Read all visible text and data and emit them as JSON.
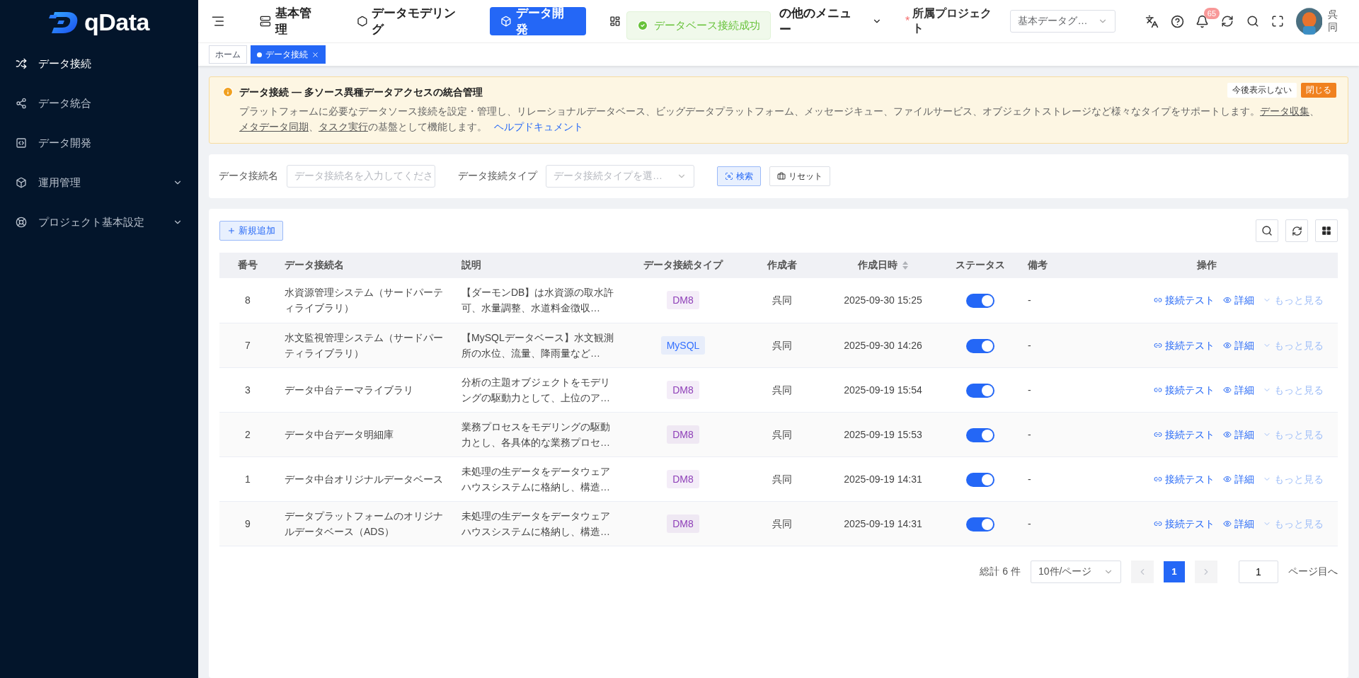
{
  "logo": {
    "text": "qData"
  },
  "sidebar": {
    "items": [
      {
        "label": "データ接続",
        "selected": true,
        "expandable": false
      },
      {
        "label": "データ統合",
        "selected": false,
        "expandable": false
      },
      {
        "label": "データ開発",
        "selected": false,
        "expandable": false
      },
      {
        "label": "運用管理",
        "selected": false,
        "expandable": true
      },
      {
        "label": "プロジェクト基本設定",
        "selected": false,
        "expandable": true
      }
    ]
  },
  "top_nav": {
    "items": [
      {
        "label": "基本管理",
        "selected": false,
        "dropdown": false
      },
      {
        "label": "データモデリング",
        "selected": false,
        "dropdown": false
      },
      {
        "label": "データ開発",
        "selected": true,
        "dropdown": false
      },
      {
        "label": "の他のメニュー",
        "selected": false,
        "dropdown": true
      }
    ]
  },
  "toast": {
    "text": "データベース接続成功"
  },
  "project": {
    "label": "所属プロジェクト",
    "required_mark": "*",
    "value": "基本データグ…"
  },
  "notifications": {
    "count": "65"
  },
  "user": {
    "name": "呉同"
  },
  "tabs": [
    {
      "label": "ホーム",
      "selected": false
    },
    {
      "label": "データ接続",
      "selected": true
    }
  ],
  "banner": {
    "title": "データ接続 — 多ソース異種データアクセスの統合管理",
    "body": [
      {
        "kind": "text",
        "text": "プラットフォームに必要なデータソース接続を設定・管理し、リレーショナルデータベース、ビッグデータプラットフォーム、メッセージキュー、ファイルサービス、オブジェクトストレージなど様々なタイプをサポートします。"
      },
      {
        "kind": "link",
        "text": "データ収集"
      },
      {
        "kind": "text",
        "text": "、"
      },
      {
        "kind": "link",
        "text": "メタデータ同期"
      },
      {
        "kind": "text",
        "text": "、"
      },
      {
        "kind": "link",
        "text": "タスク実行"
      },
      {
        "kind": "text",
        "text": "の基盤として機能します。"
      },
      {
        "kind": "help",
        "text": "ヘルプドキュメント"
      }
    ],
    "dismiss": "今後表示しない",
    "close": "閉じる"
  },
  "filters": [
    {
      "label": "データ接続名",
      "placeholder": "データ接続名を入力してくださ",
      "kind": "input"
    },
    {
      "label": "データ接続タイプ",
      "placeholder": "データ接続タイプを選…",
      "kind": "select"
    }
  ],
  "filter_buttons": {
    "search": "検索",
    "reset": "リセット"
  },
  "add_button": "新規追加",
  "table": {
    "columns": [
      {
        "label": "番号",
        "sortable": false
      },
      {
        "label": "データ接続名",
        "sortable": false
      },
      {
        "label": "説明",
        "sortable": false
      },
      {
        "label": "データ接続タイプ",
        "sortable": false
      },
      {
        "label": "作成者",
        "sortable": false
      },
      {
        "label": "作成日時",
        "sortable": true
      },
      {
        "label": "ステータス",
        "sortable": false
      },
      {
        "label": "備考",
        "sortable": false
      },
      {
        "label": "操作",
        "sortable": false
      }
    ],
    "rows": [
      {
        "no": "8",
        "name": "水資源管理システム（サードパーティライブラリ）",
        "description": "【ダーモンDB】は水資源の取水許可、水量調整、水道料金徴収…",
        "type": {
          "label": "DM8",
          "color": "#8e3fb8"
        },
        "creator": "呉同",
        "created": "2025-09-30 15:25",
        "enabled": true,
        "remarks": "-",
        "actions": [
          "接続テスト",
          "詳細",
          "もっと見る"
        ]
      },
      {
        "no": "7",
        "name": "水文監視管理システム（サードパーティライブラリ）",
        "description": "【MySQLデータベース】水文観測所の水位、流量、降雨量など…",
        "type": {
          "label": "MySQL",
          "color": "#3370ff"
        },
        "creator": "呉同",
        "created": "2025-09-30 14:26",
        "enabled": true,
        "remarks": "-",
        "actions": [
          "接続テスト",
          "詳細",
          "もっと見る"
        ]
      },
      {
        "no": "3",
        "name": "データ中台テーマライブラリ",
        "description": "分析の主題オブジェクトをモデリングの駆動力として、上位のア…",
        "type": {
          "label": "DM8",
          "color": "#8e3fb8"
        },
        "creator": "呉同",
        "created": "2025-09-19 15:54",
        "enabled": true,
        "remarks": "-",
        "actions": [
          "接続テスト",
          "詳細",
          "もっと見る"
        ]
      },
      {
        "no": "2",
        "name": "データ中台データ明細庫",
        "description": "業務プロセスをモデリングの駆動力とし、各具体的な業務プロセ…",
        "type": {
          "label": "DM8",
          "color": "#8e3fb8"
        },
        "creator": "呉同",
        "created": "2025-09-19 15:53",
        "enabled": true,
        "remarks": "-",
        "actions": [
          "接続テスト",
          "詳細",
          "もっと見る"
        ]
      },
      {
        "no": "1",
        "name": "データ中台オリジナルデータベース",
        "description": "未処理の生データをデータウェアハウスシステムに格納し、構造…",
        "type": {
          "label": "DM8",
          "color": "#8e3fb8"
        },
        "creator": "呉同",
        "created": "2025-09-19 14:31",
        "enabled": true,
        "remarks": "-",
        "actions": [
          "接続テスト",
          "詳細",
          "もっと見る"
        ]
      },
      {
        "no": "9",
        "name": "データプラットフォームのオリジナルデータベース（ADS）",
        "description": "未処理の生データをデータウェアハウスシステムに格納し、構造…",
        "type": {
          "label": "DM8",
          "color": "#8e3fb8"
        },
        "creator": "呉同",
        "created": "2025-09-19 14:31",
        "enabled": true,
        "remarks": "-",
        "actions": [
          "接続テスト",
          "詳細",
          "もっと見る"
        ]
      }
    ]
  },
  "pagination": {
    "total": "総計 6 件",
    "page_size": "10件/ページ",
    "pages": [
      {
        "label": "1",
        "selected": true
      }
    ],
    "jump_value": "1",
    "jump_label": "ページ目へ"
  }
}
